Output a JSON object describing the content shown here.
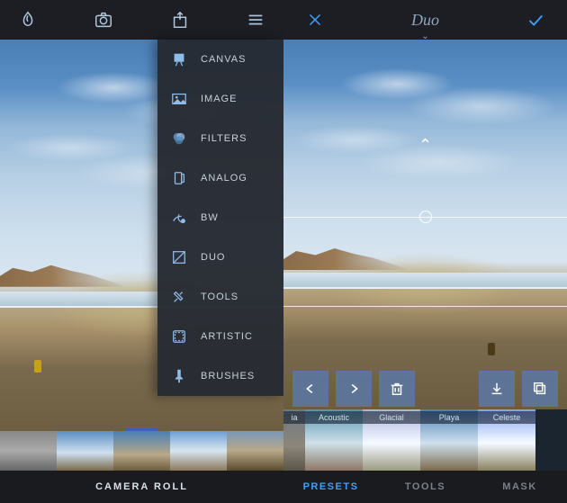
{
  "left": {
    "toolbar": {
      "logo_icon": "enlight-logo",
      "camera_icon": "camera",
      "share_icon": "share",
      "menu_icon": "hamburger"
    },
    "menu": [
      {
        "icon": "canvas",
        "label": "CANVAS"
      },
      {
        "icon": "image",
        "label": "IMAGE"
      },
      {
        "icon": "filters",
        "label": "FILTERS"
      },
      {
        "icon": "analog",
        "label": "ANALOG"
      },
      {
        "icon": "bw",
        "label": "BW"
      },
      {
        "icon": "duo",
        "label": "DUO"
      },
      {
        "icon": "tools",
        "label": "TOOLS"
      },
      {
        "icon": "artistic",
        "label": "ARTISTIC"
      },
      {
        "icon": "brushes",
        "label": "BRUSHES"
      }
    ],
    "thumbs": [
      0,
      1,
      2,
      3,
      4
    ],
    "bottom_label": "CAMERA ROLL"
  },
  "right": {
    "title": "Duo",
    "cancel_icon": "close-x",
    "confirm_icon": "checkmark",
    "actions": {
      "undo": "arrow-left",
      "redo": "arrow-right",
      "delete": "trash",
      "download": "download",
      "copy": "copy"
    },
    "presets": [
      {
        "label": "ia",
        "selected": false
      },
      {
        "label": "Acoustic",
        "selected": false
      },
      {
        "label": "Glacial",
        "selected": false
      },
      {
        "label": "Playa",
        "selected": true
      },
      {
        "label": "Celeste",
        "selected": false
      }
    ],
    "tabs": [
      {
        "label": "PRESETS",
        "active": true
      },
      {
        "label": "TOOLS",
        "active": false
      },
      {
        "label": "MASK",
        "active": false
      }
    ]
  }
}
